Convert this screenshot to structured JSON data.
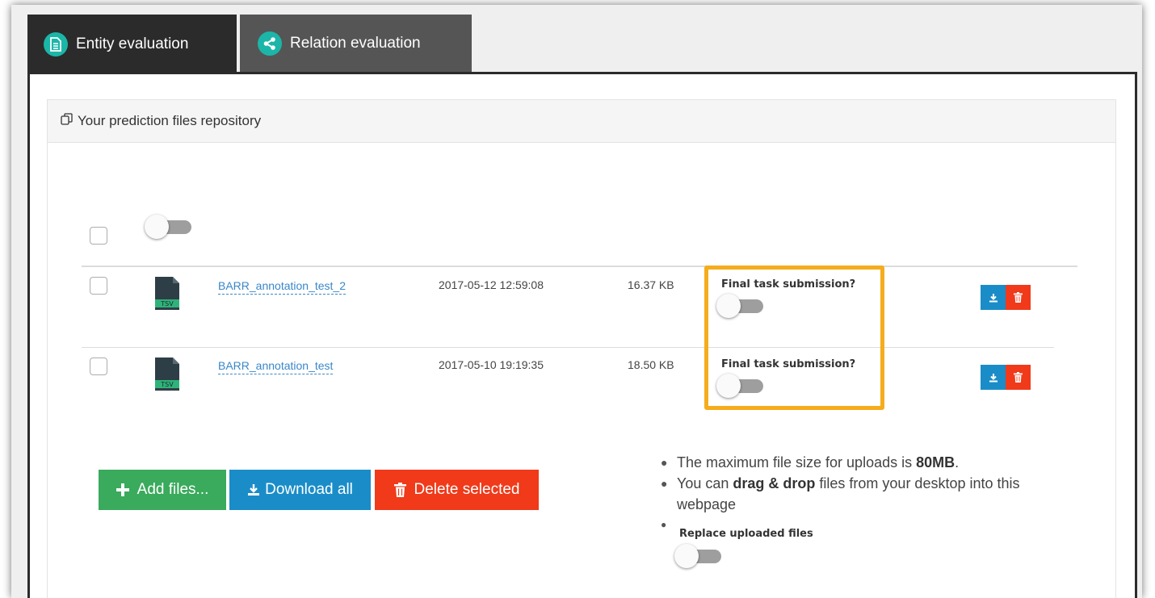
{
  "tabs": [
    {
      "label": "Entity evaluation",
      "icon": "document-icon",
      "active": true
    },
    {
      "label": "Relation evaluation",
      "icon": "share-icon",
      "active": false
    }
  ],
  "repository": {
    "title": "Your prediction files repository",
    "icon": "copy-icon"
  },
  "files": [
    {
      "name": "BARR_annotation_test_2",
      "date": "2017-05-12 12:59:08",
      "size": "16.37 KB",
      "final_label": "Final task submission?",
      "type_label": "TSV"
    },
    {
      "name": "BARR_annotation_test",
      "date": "2017-05-10 19:19:35",
      "size": "18.50 KB",
      "final_label": "Final task submission?",
      "type_label": "TSV"
    }
  ],
  "buttons": {
    "add": "Add files...",
    "download": "Download all",
    "delete": "Delete selected"
  },
  "info": {
    "line1_pre": "The maximum file size for uploads is ",
    "line1_bold": "80MB",
    "line1_post": ".",
    "line2_pre": "You can ",
    "line2_bold": "drag & drop",
    "line2_post": " files from your desktop into this webpage",
    "replace_label": "Replace uploaded files"
  },
  "colors": {
    "accent_teal": "#1bb6a8",
    "highlight": "#f5ac1d",
    "add_green": "#3aaa5c",
    "download_blue": "#1a8dc8",
    "delete_red": "#f03a1a"
  }
}
